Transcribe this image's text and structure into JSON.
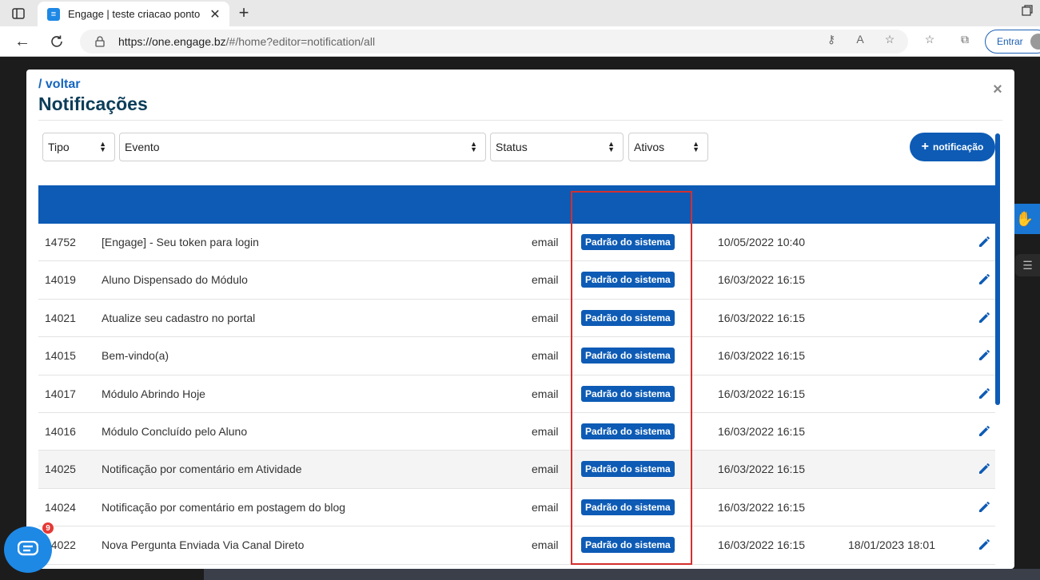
{
  "browser": {
    "tab_title": "Engage | teste criacao ponto",
    "url_host": "https://one.engage.bz",
    "url_path": "/#/home?editor=notification/all",
    "signin_label": "Entrar"
  },
  "modal": {
    "back_link": "/ voltar",
    "title": "Notificações",
    "close_symbol": "×",
    "filters": {
      "tipo": "Tipo",
      "evento": "Evento",
      "status": "Status",
      "ativos": "Ativos"
    },
    "add_button": "notificação",
    "rows": [
      {
        "id": "14752",
        "name": "[Engage] - Seu token para login",
        "type": "email",
        "status": "Padrão do sistema",
        "date": "10/05/2022 10:40",
        "date2": ""
      },
      {
        "id": "14019",
        "name": "Aluno Dispensado do Módulo",
        "type": "email",
        "status": "Padrão do sistema",
        "date": "16/03/2022 16:15",
        "date2": ""
      },
      {
        "id": "14021",
        "name": "Atualize seu cadastro no portal",
        "type": "email",
        "status": "Padrão do sistema",
        "date": "16/03/2022 16:15",
        "date2": ""
      },
      {
        "id": "14015",
        "name": "Bem-vindo(a)",
        "type": "email",
        "status": "Padrão do sistema",
        "date": "16/03/2022 16:15",
        "date2": ""
      },
      {
        "id": "14017",
        "name": "Módulo Abrindo Hoje",
        "type": "email",
        "status": "Padrão do sistema",
        "date": "16/03/2022 16:15",
        "date2": ""
      },
      {
        "id": "14016",
        "name": "Módulo Concluído pelo Aluno",
        "type": "email",
        "status": "Padrão do sistema",
        "date": "16/03/2022 16:15",
        "date2": ""
      },
      {
        "id": "14025",
        "name": "Notificação por comentário em Atividade",
        "type": "email",
        "status": "Padrão do sistema",
        "date": "16/03/2022 16:15",
        "date2": ""
      },
      {
        "id": "14024",
        "name": "Notificação por comentário em postagem do blog",
        "type": "email",
        "status": "Padrão do sistema",
        "date": "16/03/2022 16:15",
        "date2": ""
      },
      {
        "id": "14022",
        "name": "Nova Pergunta Enviada Via Canal Direto",
        "type": "email",
        "status": "Padrão do sistema",
        "date": "16/03/2022 16:15",
        "date2": "18/01/2023 18:01"
      }
    ]
  },
  "chat": {
    "badge_count": "9"
  },
  "colors": {
    "primary": "#0d5bb5",
    "highlight_border": "#d32f2f"
  }
}
